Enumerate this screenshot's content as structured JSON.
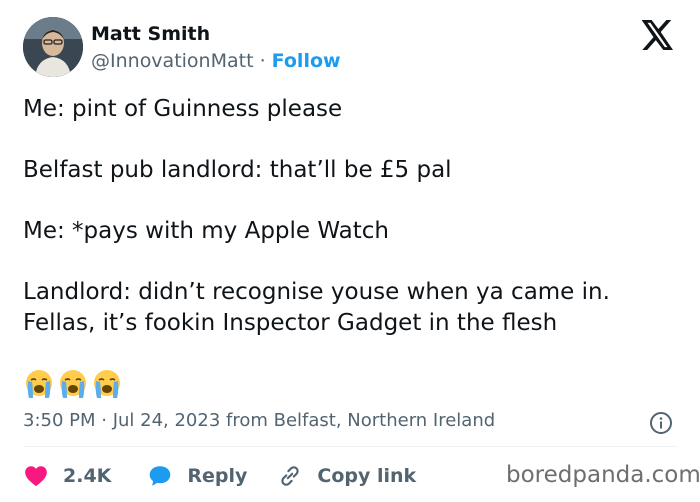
{
  "author": {
    "name": "Matt Smith",
    "handle": "@InnovationMatt",
    "separator": "·",
    "follow_label": "Follow"
  },
  "tweet": {
    "lines": [
      "Me: pint of Guinness please",
      "Belfast pub landlord: that’ll be £5 pal",
      "Me: *pays with my Apple Watch",
      "Landlord: didn’t recognise youse when ya came in.",
      "Fellas, it’s fookin Inspector Gadget in the flesh"
    ],
    "emoji_name": "loudly-crying-face",
    "emoji_count": 3
  },
  "meta": {
    "timestamp": "3:50 PM · Jul 24, 2023 from Belfast, Northern Ireland"
  },
  "actions": {
    "likes": "2.4K",
    "reply_label": "Reply",
    "copy_link_label": "Copy link"
  },
  "watermark": "boredpanda.com",
  "colors": {
    "text": "#0f1419",
    "muted": "#536471",
    "link": "#1d9bf0",
    "heart": "#f91880",
    "reply_bubble": "#1d9bf0"
  }
}
